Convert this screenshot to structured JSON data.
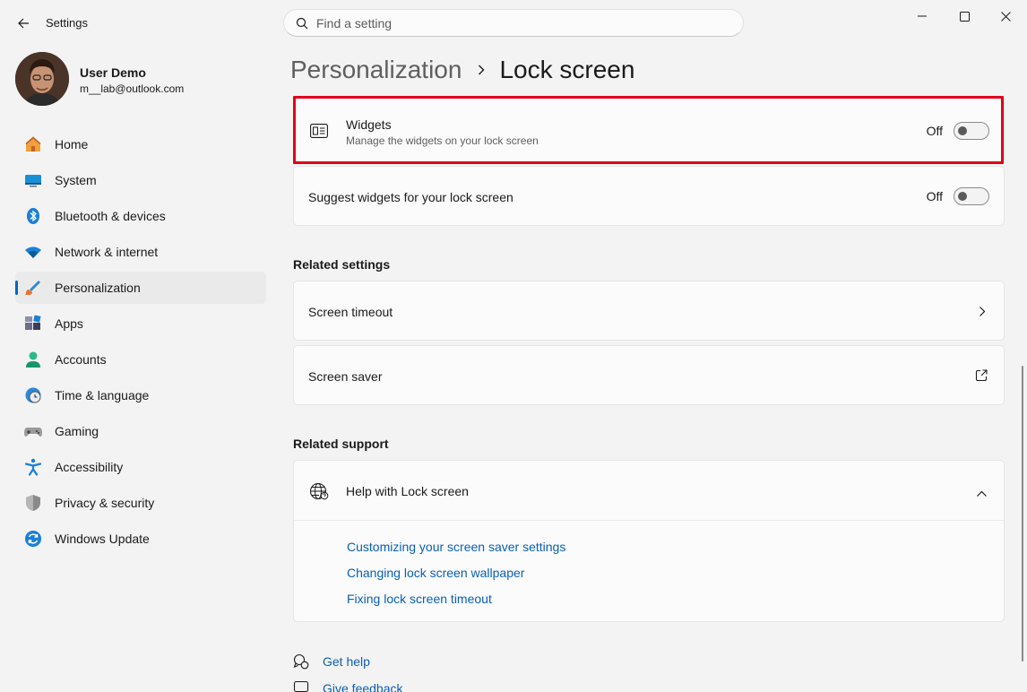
{
  "app": {
    "title": "Settings"
  },
  "search": {
    "placeholder": "Find a setting"
  },
  "profile": {
    "name": "User Demo",
    "email": "m__lab@outlook.com"
  },
  "sidebar": {
    "items": [
      {
        "label": "Home",
        "icon": "home-icon"
      },
      {
        "label": "System",
        "icon": "system-icon"
      },
      {
        "label": "Bluetooth & devices",
        "icon": "bluetooth-icon"
      },
      {
        "label": "Network & internet",
        "icon": "wifi-icon"
      },
      {
        "label": "Personalization",
        "icon": "brush-icon",
        "active": true
      },
      {
        "label": "Apps",
        "icon": "apps-icon"
      },
      {
        "label": "Accounts",
        "icon": "account-icon"
      },
      {
        "label": "Time & language",
        "icon": "clock-globe-icon"
      },
      {
        "label": "Gaming",
        "icon": "gamepad-icon"
      },
      {
        "label": "Accessibility",
        "icon": "accessibility-icon"
      },
      {
        "label": "Privacy & security",
        "icon": "shield-icon"
      },
      {
        "label": "Windows Update",
        "icon": "update-icon"
      }
    ]
  },
  "breadcrumb": {
    "parent": "Personalization",
    "current": "Lock screen"
  },
  "widgets": {
    "title": "Widgets",
    "subtitle": "Manage the widgets on your lock screen",
    "state": "Off"
  },
  "suggest": {
    "title": "Suggest widgets for your lock screen",
    "state": "Off"
  },
  "related_settings": {
    "title": "Related settings",
    "screen_timeout": "Screen timeout",
    "screen_saver": "Screen saver"
  },
  "related_support": {
    "title": "Related support",
    "help_title": "Help with Lock screen",
    "links": [
      "Customizing your screen saver settings",
      "Changing lock screen wallpaper",
      "Fixing lock screen timeout"
    ]
  },
  "footer": {
    "get_help": "Get help",
    "feedback": "Give feedback"
  },
  "colors": {
    "accent": "#0067c0",
    "highlight": "#e0001b",
    "link": "#0a5fb4"
  }
}
